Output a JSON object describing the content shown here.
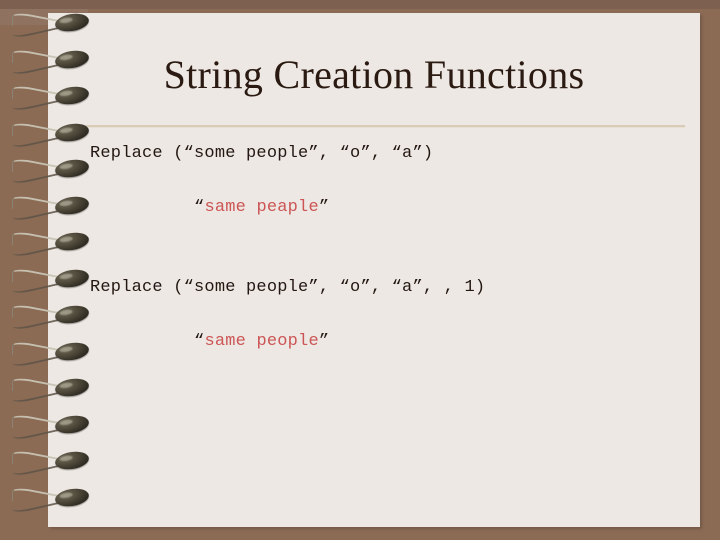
{
  "slide": {
    "title": "String Creation Functions",
    "background_color": "#8C6B55",
    "page_color": "#EDE8E3",
    "title_color": "#2B1A12",
    "rule_color": "#D8CCB8",
    "code_color": "#241711",
    "result_color": "#CC5555"
  },
  "blocks": [
    {
      "call": "Replace (“some people”, “o”, “a”)",
      "result_open_quote": "“",
      "result_text": "same peaple",
      "result_close_quote": "”"
    },
    {
      "call": "Replace (“some people”, “o”, “a”, , 1)",
      "result_open_quote": "“",
      "result_text": "same people",
      "result_close_quote": "”"
    }
  ],
  "binding": {
    "coil_count": 14,
    "icon": "spiral-coil"
  }
}
